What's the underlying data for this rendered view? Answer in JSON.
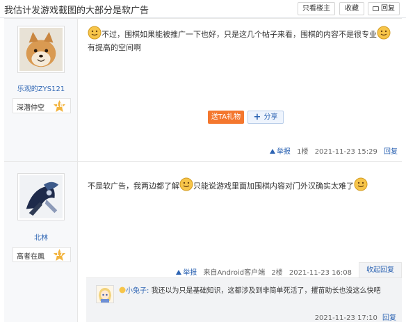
{
  "header": {
    "title": "我估计发游戏截图的大部分是软广告",
    "only_owner_label": "只看楼主",
    "favorite_label": "收藏",
    "reply_label": "回复"
  },
  "posts": [
    {
      "username": "乐观的ZYS121",
      "level_title": "深潜仲空",
      "level_num": "18",
      "content_part1": "不过，围棋如果能被推广一下也好，只是这几个帖子来看，围棋的内容不是很专业",
      "content_part2": "有提高的空间啊",
      "gift_label": "送TA礼物",
      "share_label": "分享",
      "report_label": "举报",
      "floor": "1楼",
      "time": "2021-11-23 15:29",
      "reply_label": "回复"
    },
    {
      "username": "北林",
      "level_title": "高者在鳳",
      "level_num": "17",
      "content_part1": "不是软广告，我两边都了解",
      "content_part2": "只能说游戏里面加围棋内容对门外汉确实太难了",
      "report_label": "举报",
      "source": "来自Android客户端",
      "floor": "2楼",
      "time": "2021-11-23 16:08",
      "fold_reply_label": "收起回复",
      "subreply": {
        "name": "小兔子:",
        "text": "我还以为只是基础知识，这都涉及到非简单死活了，攫苗助长也没这么快吧",
        "time": "2021-11-23 17:10",
        "reply_label": "回复"
      }
    }
  ],
  "colors": {
    "link": "#2d64b3",
    "gift": "#f4772e",
    "sidebar": "#f7f8fa"
  }
}
